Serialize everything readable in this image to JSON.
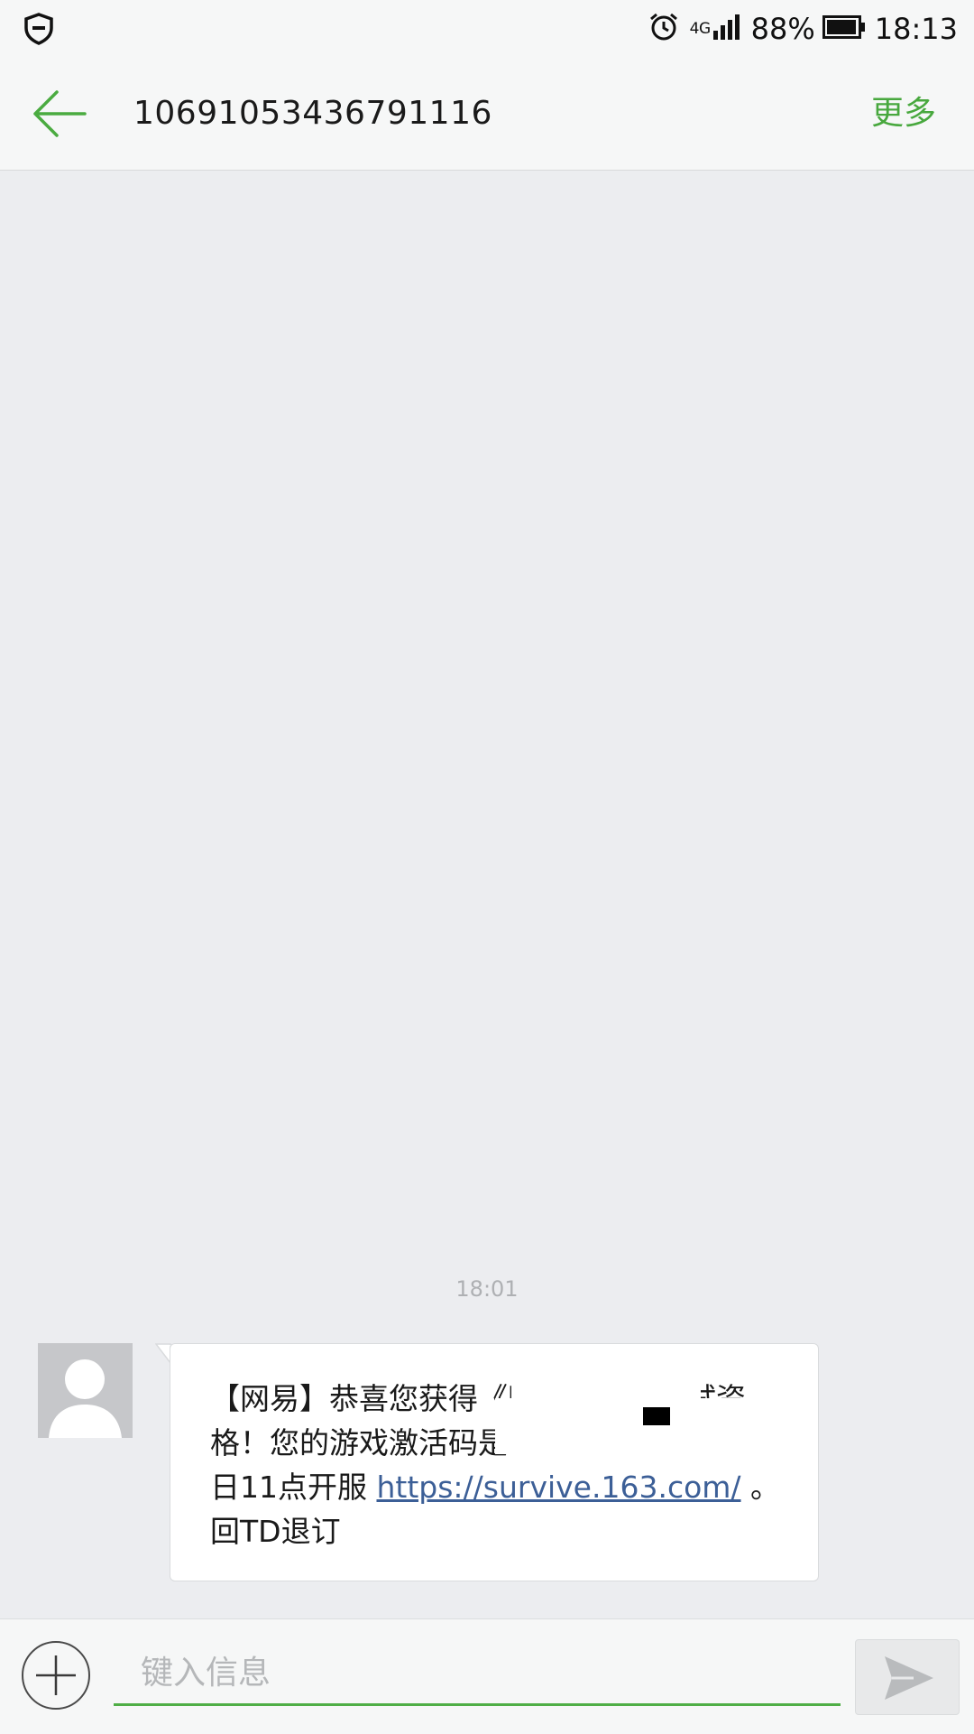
{
  "status_bar": {
    "network": "4G",
    "battery": "88%",
    "time": "18:13"
  },
  "header": {
    "title": "10691053436791116",
    "more_label": "更多",
    "accent_color": "#48a83e"
  },
  "conversation": {
    "timestamp": "18:01",
    "message": {
      "line1": "【网易】恭喜您获得《明日之后》测试资",
      "line2": "格！您的游戏激活码是",
      "line3_prefix": "日11点开服 ",
      "link": "https://survive.163.com/",
      "line3_suffix": " 。",
      "line4": "回TD退订"
    }
  },
  "input": {
    "placeholder": "键入信息"
  },
  "icons": [
    "shield-icon",
    "alarm-icon",
    "signal-icon",
    "battery-icon",
    "back-arrow-icon",
    "contact-avatar-icon",
    "plus-icon",
    "send-icon"
  ]
}
